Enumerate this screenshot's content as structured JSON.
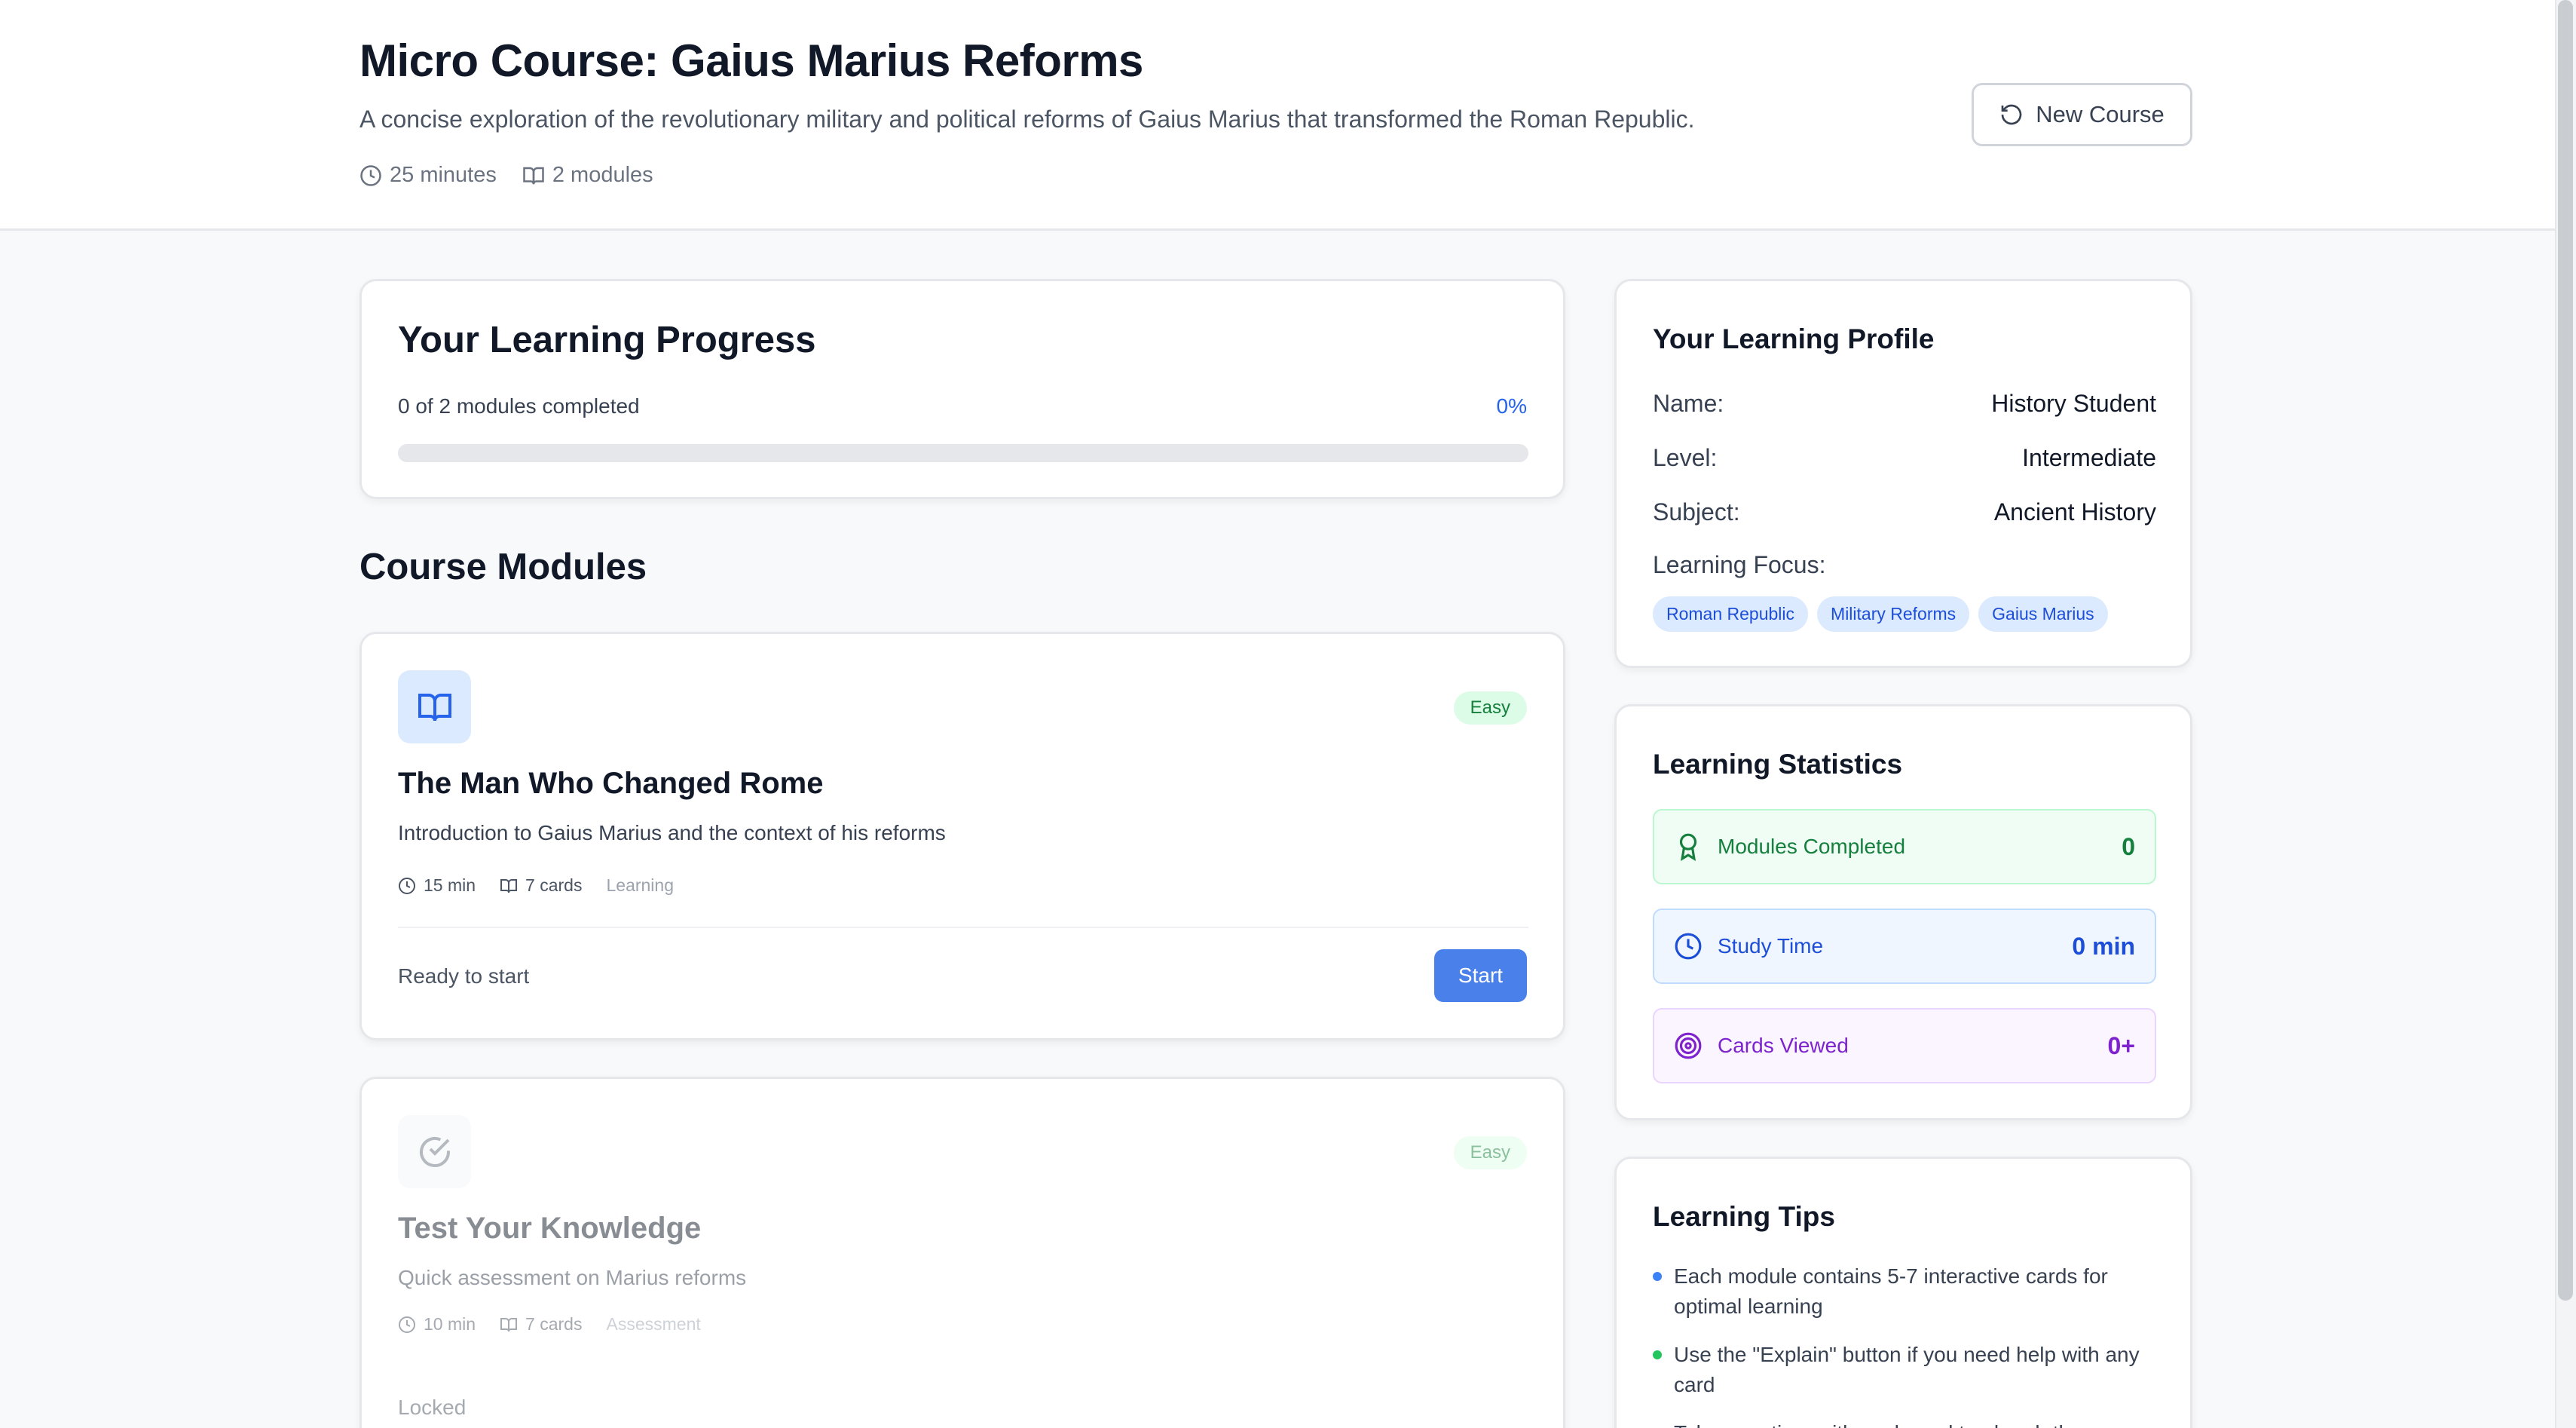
{
  "header": {
    "title": "Micro Course: Gaius Marius Reforms",
    "subtitle": "A concise exploration of the revolutionary military and political reforms of Gaius Marius that transformed the Roman Republic.",
    "duration": "25 minutes",
    "modules": "2 modules",
    "new_course_label": "New Course"
  },
  "progress": {
    "title": "Your Learning Progress",
    "completed_text": "0 of 2 modules completed",
    "percent_text": "0%",
    "fraction": 0
  },
  "modules_section": {
    "title": "Course Modules",
    "items": [
      {
        "difficulty": "Easy",
        "title": "The Man Who Changed Rome",
        "description": "Introduction to Gaius Marius and the context of his reforms",
        "duration": "15 min",
        "cards": "7 cards",
        "type": "Learning",
        "status": "Ready to start",
        "action": "Start"
      },
      {
        "difficulty": "Easy",
        "title": "Test Your Knowledge",
        "description": "Quick assessment on Marius reforms",
        "duration": "10 min",
        "cards": "7 cards",
        "type": "Assessment",
        "status": "Locked"
      }
    ]
  },
  "profile": {
    "title": "Your Learning Profile",
    "rows": [
      {
        "label": "Name:",
        "value": "History Student"
      },
      {
        "label": "Level:",
        "value": "Intermediate"
      },
      {
        "label": "Subject:",
        "value": "Ancient History"
      }
    ],
    "focus_label": "Learning Focus:",
    "tags": [
      "Roman Republic",
      "Military Reforms",
      "Gaius Marius"
    ]
  },
  "stats": {
    "title": "Learning Statistics",
    "items": [
      {
        "label": "Modules Completed",
        "value": "0",
        "color": "#15803d"
      },
      {
        "label": "Study Time",
        "value": "0 min",
        "color": "#1d4ed8"
      },
      {
        "label": "Cards Viewed",
        "value": "0+",
        "color": "#7e22ce"
      }
    ]
  },
  "tips": {
    "title": "Learning Tips",
    "items": [
      {
        "text": "Each module contains 5-7 interactive cards for optimal learning",
        "color": "#3b82f6"
      },
      {
        "text": "Use the \"Explain\" button if you need help with any card",
        "color": "#22c55e"
      },
      {
        "text": "Take your time with each card to absorb the content",
        "color": "#a855f7"
      }
    ]
  },
  "colors": {
    "accent": "#4a80ea",
    "background": "#f8f9fa"
  }
}
